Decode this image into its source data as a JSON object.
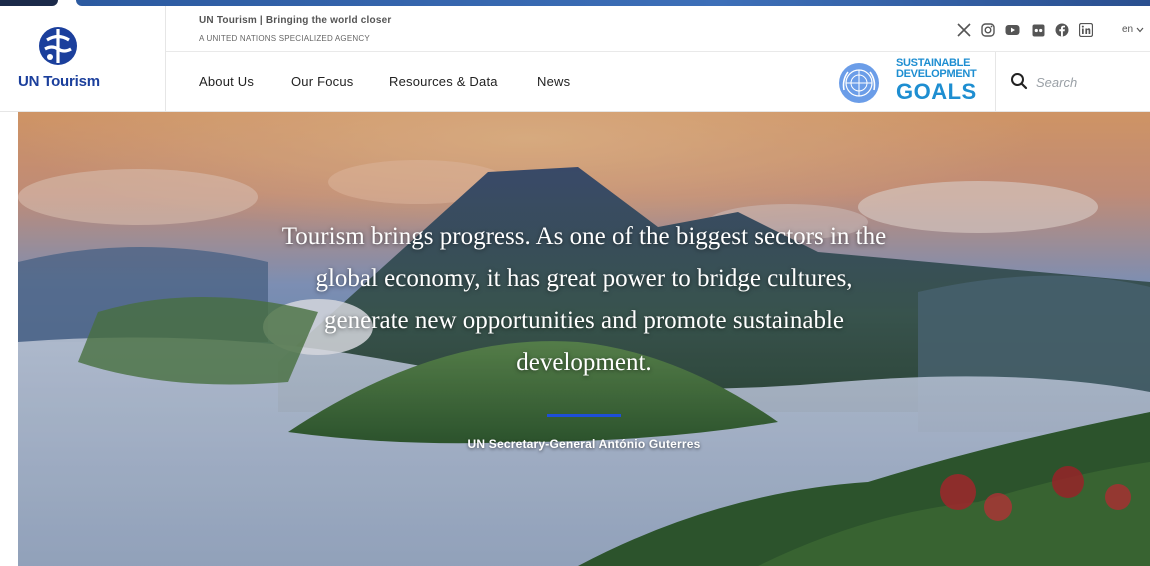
{
  "brand": {
    "name": "UN Tourism",
    "tagline": "UN Tourism | Bringing the world closer",
    "subtagline": "A UNITED NATIONS SPECIALIZED AGENCY",
    "color": "#1b3f9c"
  },
  "social": [
    {
      "name": "x-icon",
      "label": "X"
    },
    {
      "name": "instagram-icon",
      "label": "Instagram"
    },
    {
      "name": "youtube-icon",
      "label": "YouTube"
    },
    {
      "name": "flickr-icon",
      "label": "Flickr"
    },
    {
      "name": "facebook-icon",
      "label": "Facebook"
    },
    {
      "name": "linkedin-icon",
      "label": "LinkedIn"
    }
  ],
  "language": {
    "selected": "en"
  },
  "nav": {
    "items": [
      {
        "label": "About Us"
      },
      {
        "label": "Our Focus"
      },
      {
        "label": "Resources & Data"
      },
      {
        "label": "News"
      }
    ]
  },
  "sdg": {
    "line1": "SUSTAINABLE",
    "line2": "DEVELOPMENT",
    "line3": "GOALS",
    "color": "#1e8ed1"
  },
  "search": {
    "placeholder": "Search",
    "value": ""
  },
  "hero": {
    "quote_lines": [
      "Tourism brings progress. As one of the biggest sectors in the",
      "global economy, it has great power to bridge cultures,",
      "generate new opportunities and promote sustainable",
      "development."
    ],
    "author": "UN Secretary-General António Guterres",
    "accent": "#1e4fd8"
  }
}
